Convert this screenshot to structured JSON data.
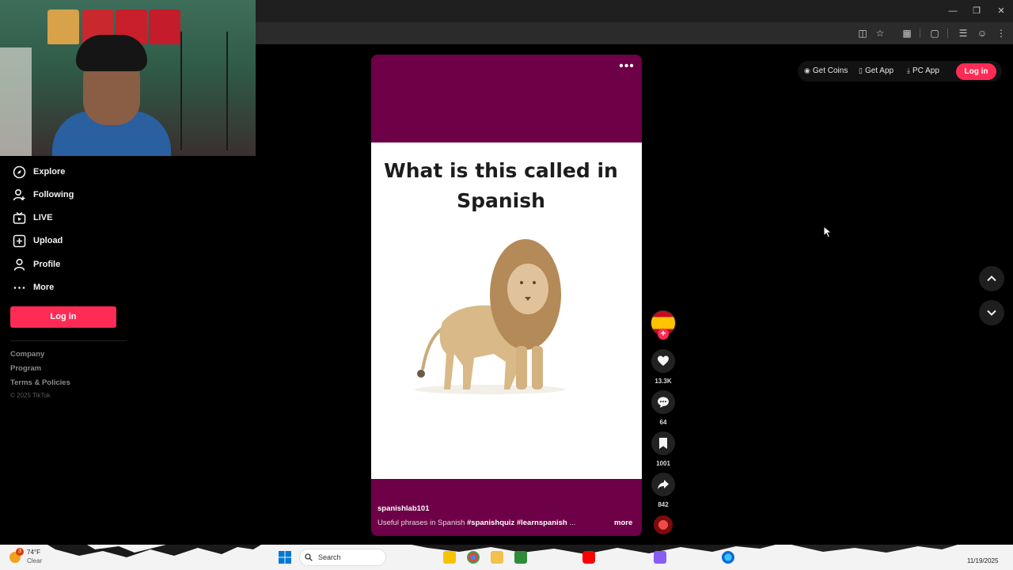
{
  "sidebar": {
    "nav": [
      {
        "label": "Explore",
        "icon": "compass-icon"
      },
      {
        "label": "Following",
        "icon": "user-plus-icon"
      },
      {
        "label": "LIVE",
        "icon": "live-tv-icon"
      },
      {
        "label": "Upload",
        "icon": "plus-square-icon"
      },
      {
        "label": "Profile",
        "icon": "person-icon"
      },
      {
        "label": "More",
        "icon": "more-dots-icon"
      }
    ],
    "login_label": "Log in",
    "footer": {
      "links": [
        "Company",
        "Program",
        "Terms & Policies"
      ],
      "copyright": "© 2025 TikTok"
    }
  },
  "header": {
    "links": [
      {
        "label": "Get Coins",
        "icon": "coin-icon"
      },
      {
        "label": "Get App",
        "icon": "phone-icon"
      },
      {
        "label": "PC App",
        "icon": "download-icon"
      }
    ],
    "login_label": "Log in"
  },
  "video": {
    "title": "What is this called in Spanish",
    "author": "spanishlab101",
    "caption_text": "Useful phrases in Spanish",
    "hashtags": [
      "#spanishquiz",
      "#learnspanish"
    ],
    "ellipsis": "...",
    "more_label": "more",
    "colors": {
      "brand": "#6d0047",
      "accent": "#fe2c55"
    }
  },
  "actions": {
    "likes": "13.3K",
    "comments": "64",
    "saves": "1001",
    "shares": "842"
  },
  "taskbar": {
    "temperature": "74°F",
    "condition": "Clear",
    "notification_count": "3",
    "search_label": "Search",
    "date": "11/19/2025"
  }
}
